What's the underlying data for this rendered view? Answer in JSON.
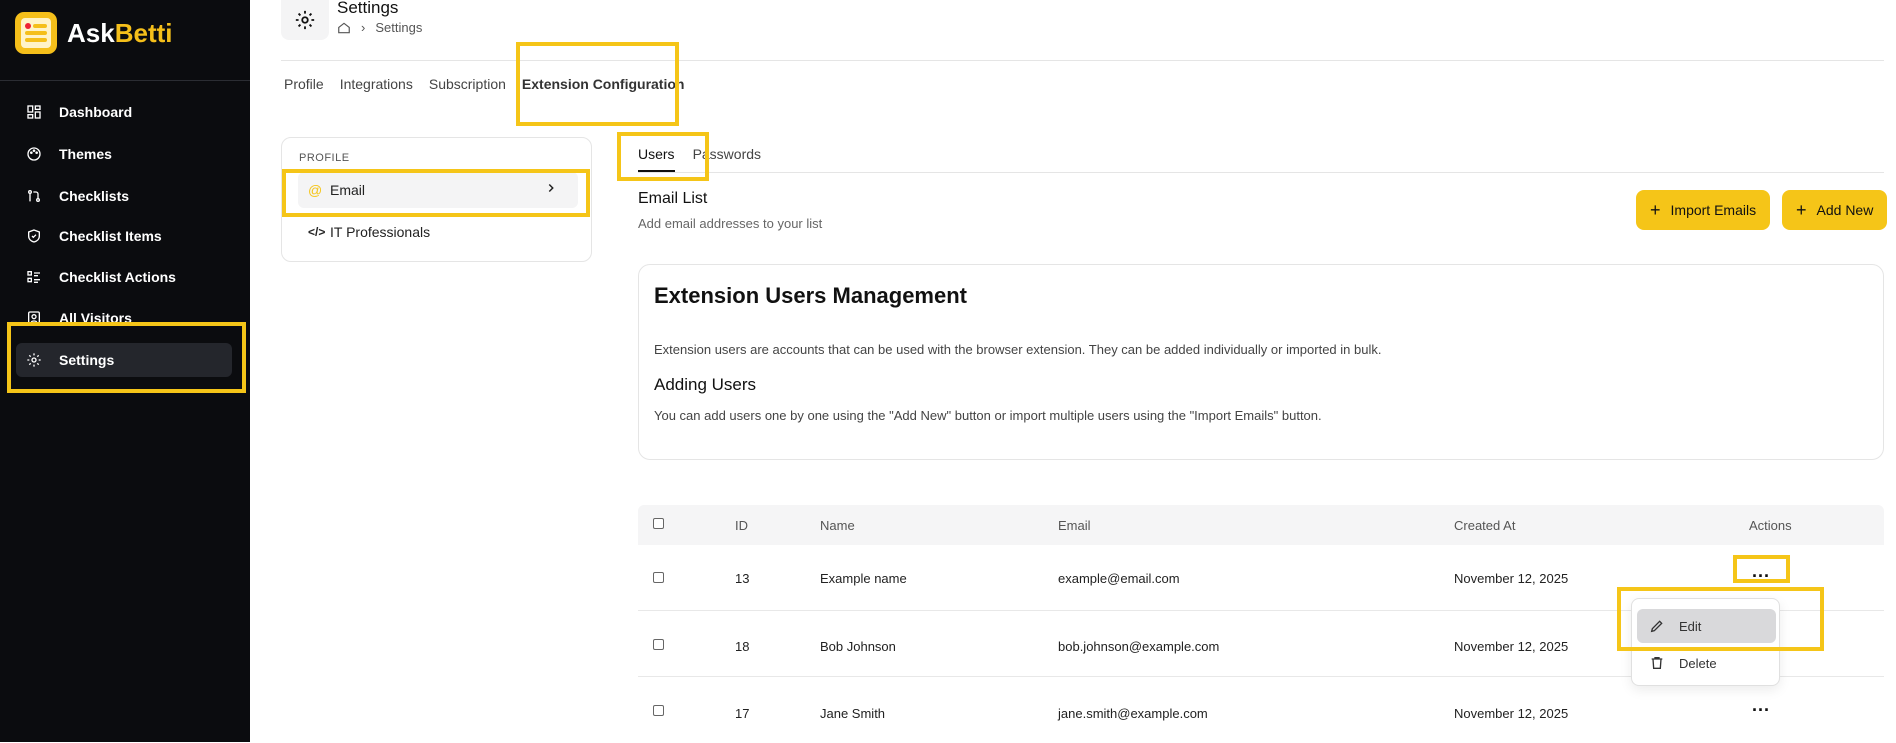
{
  "app": {
    "name_part1": "Ask",
    "name_part2": "Betti",
    "accent_color": "#f5c518"
  },
  "sidebar": {
    "items": [
      {
        "label": "Dashboard",
        "icon": "dashboard-icon"
      },
      {
        "label": "Themes",
        "icon": "palette-icon"
      },
      {
        "label": "Checklists",
        "icon": "git-pull-icon"
      },
      {
        "label": "Checklist Items",
        "icon": "shield-check-icon"
      },
      {
        "label": "Checklist Actions",
        "icon": "list-icon"
      },
      {
        "label": "All Visitors",
        "icon": "user-badge-icon"
      },
      {
        "label": "Settings",
        "icon": "gear-icon",
        "active": true
      }
    ]
  },
  "header": {
    "title": "Settings",
    "breadcrumb_current": "Settings"
  },
  "tabs": [
    "Profile",
    "Integrations",
    "Subscription",
    "Extension Configuration"
  ],
  "profile_panel": {
    "section_label": "PROFILE",
    "items": [
      {
        "label": "Email",
        "icon": "at-icon",
        "selected": true
      },
      {
        "label": "IT Professionals",
        "icon": "code-icon"
      }
    ]
  },
  "sub_tabs": [
    "Users",
    "Passwords"
  ],
  "email_list": {
    "title": "Email List",
    "subtitle": "Add email addresses to your list",
    "import_label": "Import Emails",
    "add_label": "Add New"
  },
  "info": {
    "title": "Extension Users Management",
    "p1": "Extension users are accounts that can be used with the browser extension. They can be added individually or imported in bulk.",
    "h2": "Adding Users",
    "p2": "You can add users one by one using the \"Add New\" button or import multiple users using the \"Import Emails\" button."
  },
  "table": {
    "headers": {
      "id": "ID",
      "name": "Name",
      "email": "Email",
      "created": "Created At",
      "actions": "Actions"
    },
    "rows": [
      {
        "id": "13",
        "name": "Example name",
        "email": "example@email.com",
        "created": "November 12, 2025",
        "actions": "..."
      },
      {
        "id": "18",
        "name": "Bob Johnson",
        "email": "bob.johnson@example.com",
        "created": "November 12, 2025",
        "actions": ""
      },
      {
        "id": "17",
        "name": "Jane Smith",
        "email": "jane.smith@example.com",
        "created": "November 12, 2025",
        "actions": "..."
      }
    ]
  },
  "row_menu": {
    "edit_label": "Edit",
    "delete_label": "Delete"
  }
}
